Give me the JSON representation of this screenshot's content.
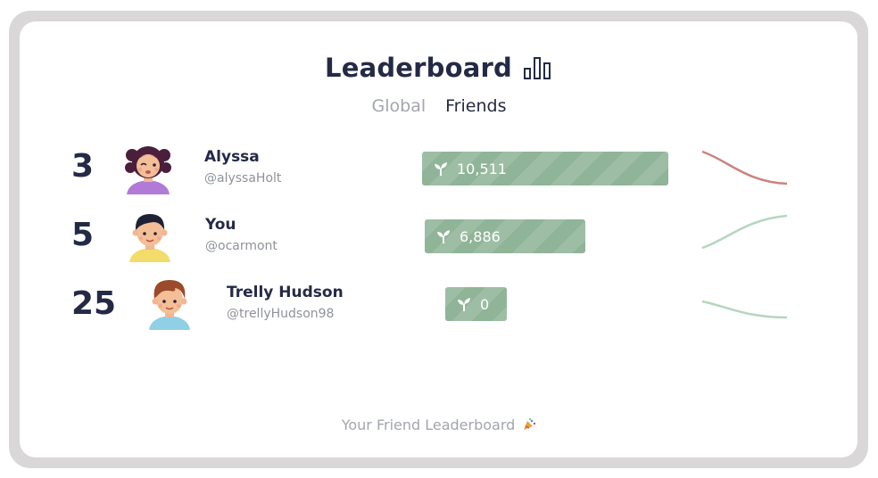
{
  "header": {
    "title": "Leaderboard",
    "title_icon": "bar-chart-icon"
  },
  "tabs": [
    {
      "label": "Global",
      "active": false
    },
    {
      "label": "Friends",
      "active": true
    }
  ],
  "leaderboard": [
    {
      "rank": "3",
      "name": "Alyssa",
      "handle": "@alyssaHolt",
      "score": "10,511",
      "score_value": 10511,
      "trend": "down",
      "trend_color": "#c9847f",
      "avatar": "girl-avatar"
    },
    {
      "rank": "5",
      "name": "You",
      "handle": "@ocarmont",
      "score": "6,886",
      "score_value": 6886,
      "trend": "up",
      "trend_color": "#b5d6bf",
      "avatar": "boy-avatar"
    },
    {
      "rank": "25",
      "name": "Trelly Hudson",
      "handle": "@trellyHudson98",
      "score": "0",
      "score_value": 0,
      "trend": "down",
      "trend_color": "#b5d6bf",
      "avatar": "boy-avatar-brown-hair"
    }
  ],
  "score_icon": "sprout-icon",
  "footer": {
    "text": "Your Friend Leaderboard",
    "icon": "party-popper-icon"
  },
  "colors": {
    "accent_bar": "#9dbea4",
    "text_dark": "#242a46",
    "text_muted": "#a3a6ad",
    "trend_down_red": "#c9847f",
    "trend_green": "#b5d6bf"
  }
}
